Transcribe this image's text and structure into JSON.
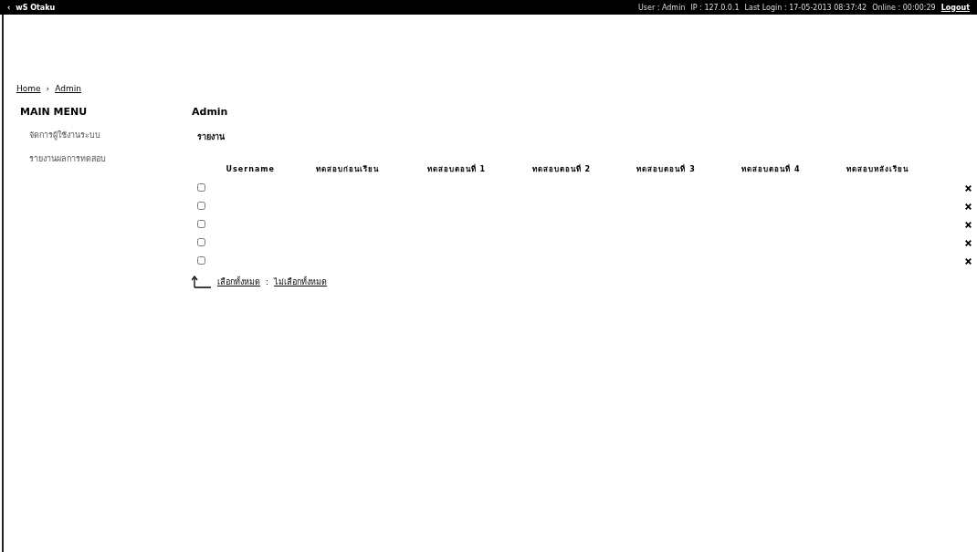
{
  "top_bar": {
    "back": "‹",
    "site": "wS Otaku",
    "info": [
      "User : Admin",
      "IP : 127.0.0.1",
      "Last Login : 17-05-2013 08:37:42",
      "Online : 00:00:29"
    ],
    "logout": "Logout"
  },
  "breadcrumb": [
    "Home",
    "Admin"
  ],
  "breadcrumb_separator": "›",
  "sidebar": {
    "title": "MAIN MENU",
    "items": [
      "จัดการผู้ใช้งานระบบ",
      "รายงานผลการทดสอบ"
    ]
  },
  "content": {
    "title": "Admin",
    "subtitle": "รายงาน",
    "table": {
      "columns": [
        "Username",
        "ทดสอบก่อนเรียน",
        "ทดสอบตอนที่ 1",
        "ทดสอบตอนที่ 2",
        "ทดสอบตอนที่ 3",
        "ทดสอบตอนที่ 4",
        "ทดสอบหลังเรียน"
      ],
      "rows": [
        {
          "selected": false
        },
        {
          "selected": false
        },
        {
          "selected": false
        },
        {
          "selected": false
        },
        {
          "selected": false
        }
      ]
    },
    "actions": [
      "เลือกทั้งหมด",
      "ไม่เลือกทั้งหมด"
    ],
    "actions_separator": ":"
  }
}
